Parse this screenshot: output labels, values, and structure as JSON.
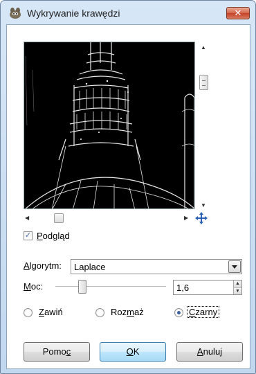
{
  "window": {
    "title": "Wykrywanie krawędzi",
    "close_label": "✕"
  },
  "preview": {
    "label_pre": "",
    "label_u": "P",
    "label_rest": "odgląd",
    "checked": true,
    "check_glyph": "✓"
  },
  "algorithm": {
    "label_u": "A",
    "label_rest": "lgorytm:",
    "value": "Laplace"
  },
  "amount": {
    "label_u": "M",
    "label_rest": "oc:",
    "value": "1,6"
  },
  "edge_mode": {
    "wrap": {
      "u": "Z",
      "rest": "awiń"
    },
    "smear": {
      "pre": "Roz",
      "u": "m",
      "rest": "aż"
    },
    "black": {
      "u": "C",
      "rest": "zarny"
    },
    "selected": "black"
  },
  "buttons": {
    "help": {
      "pre": "Pomo",
      "u": "c",
      "rest": ""
    },
    "ok": {
      "pre": "",
      "u": "O",
      "rest": "K"
    },
    "cancel": {
      "pre": "",
      "u": "A",
      "rest": "nuluj"
    }
  },
  "icons": {
    "app": "wilber-icon",
    "navigate": "navigate-cross-icon"
  }
}
